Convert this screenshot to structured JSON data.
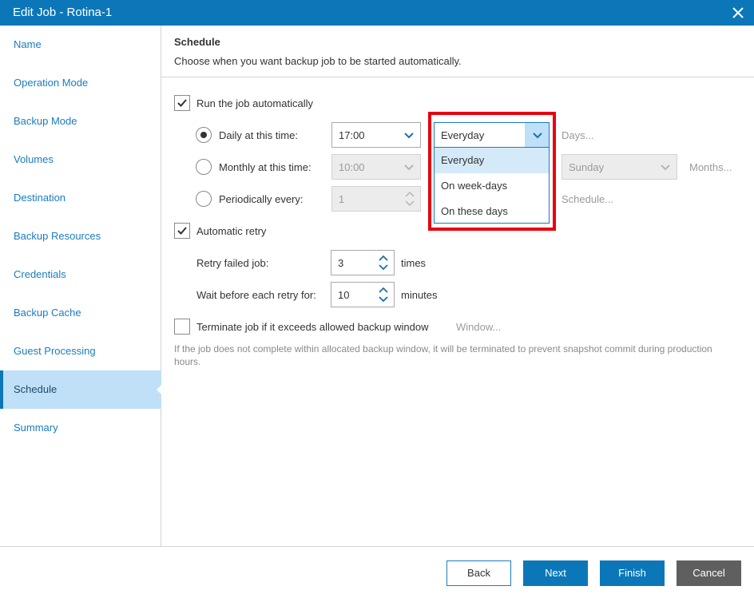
{
  "window": {
    "title": "Edit Job - Rotina-1"
  },
  "sidebar": {
    "items": [
      {
        "label": "Name"
      },
      {
        "label": "Operation Mode"
      },
      {
        "label": "Backup Mode"
      },
      {
        "label": "Volumes"
      },
      {
        "label": "Destination"
      },
      {
        "label": "Backup Resources"
      },
      {
        "label": "Credentials"
      },
      {
        "label": "Backup Cache"
      },
      {
        "label": "Guest Processing"
      },
      {
        "label": "Schedule",
        "active": true
      },
      {
        "label": "Summary"
      }
    ]
  },
  "section": {
    "title": "Schedule",
    "subtitle": "Choose when you want backup job to be started automatically."
  },
  "schedule": {
    "run_auto": {
      "label": "Run the job automatically",
      "checked": true
    },
    "daily": {
      "label": "Daily at this time:",
      "time": "17:00",
      "selected": true,
      "days_value": "Everyday",
      "days_link": "Days..."
    },
    "monthly": {
      "label": "Monthly at this time:",
      "time": "10:00",
      "day_value": "Sunday",
      "months_link": "Months..."
    },
    "periodically": {
      "label": "Periodically every:",
      "value": "1",
      "schedule_link": "Schedule..."
    },
    "dropdown_options": [
      "Everyday",
      "On week-days",
      "On these days"
    ],
    "retry": {
      "label": "Automatic retry",
      "checked": true,
      "failed_label": "Retry failed job:",
      "failed_value": "3",
      "failed_unit": "times",
      "wait_label": "Wait before each retry for:",
      "wait_value": "10",
      "wait_unit": "minutes"
    },
    "terminate": {
      "label": "Terminate job if it exceeds allowed backup window",
      "checked": false,
      "window_link": "Window...",
      "note": "If the job does not complete within allocated backup window, it will be terminated to prevent snapshot commit during production hours."
    }
  },
  "footer": {
    "back": "Back",
    "next": "Next",
    "finish": "Finish",
    "cancel": "Cancel"
  },
  "colors": {
    "accent": "#0b77b8",
    "highlight": "#e8000f",
    "active_nav": "#bfe0f7"
  }
}
